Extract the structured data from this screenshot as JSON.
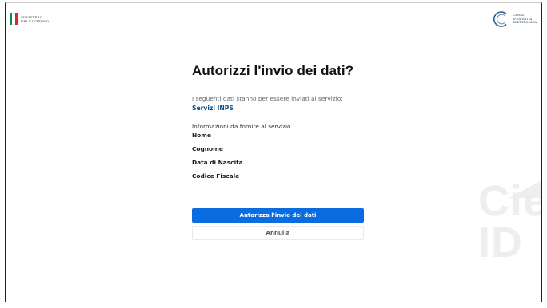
{
  "header": {
    "ministry_line1": "MINISTERO",
    "ministry_line2": "DELL'INTERNO",
    "cie_line1": "CARTA",
    "cie_line2": "D'IDENTITÀ",
    "cie_line3": "ELETTRONICA",
    "flag_colors": [
      "#009246",
      "#ffffff",
      "#ce2b37"
    ]
  },
  "main": {
    "title": "Autorizzi l'invio dei dati?",
    "subtitle": "I seguenti dati stanno per essere inviati al servizio:",
    "service_name": "Servizi INPS",
    "info_title": "Informazioni da fornire al servizio",
    "fields": [
      "Nome",
      "Cognome",
      "Data di Nascita",
      "Codice Fiscale"
    ]
  },
  "actions": {
    "authorize_label": "Autorizza l'invio dei dati",
    "cancel_label": "Annulla"
  },
  "watermark": {
    "line1": "Cie",
    "line2": "ID"
  },
  "colors": {
    "primary": "#0a6cde",
    "service": "#0a4f86"
  }
}
